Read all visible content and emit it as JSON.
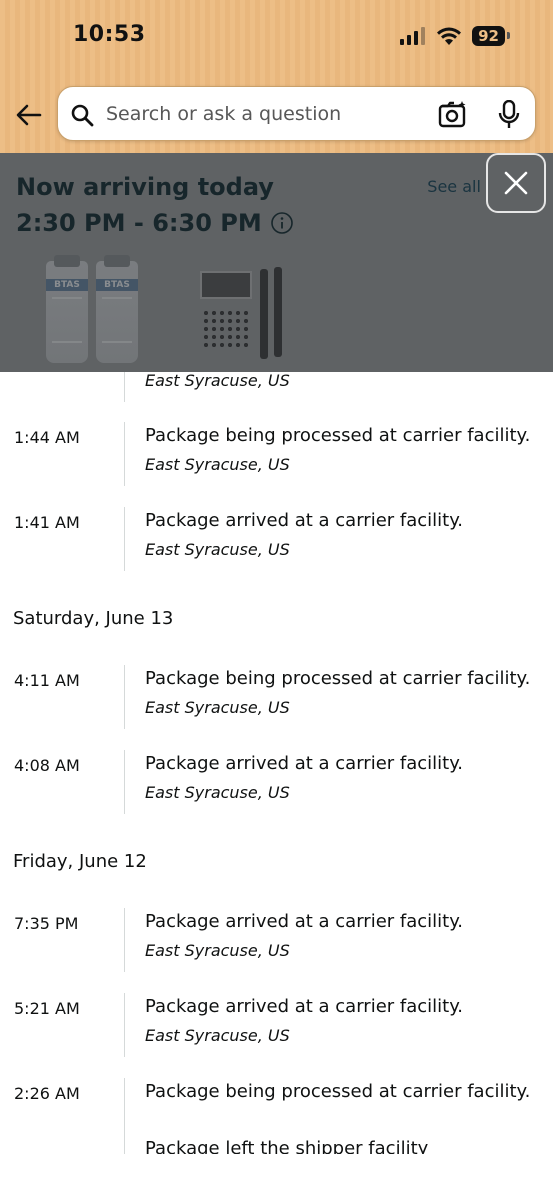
{
  "status_bar": {
    "time": "10:53",
    "battery": "92"
  },
  "search": {
    "placeholder": "Search or ask a question"
  },
  "arrival": {
    "title": "Now arriving today",
    "window": "2:30 PM - 6:30 PM",
    "see_all": "See all orders",
    "products": [
      "BTAS",
      "BTAS"
    ]
  },
  "timeline": {
    "partial_location": "East Syracuse, US",
    "groups": [
      {
        "date": "",
        "events": [
          {
            "time": "1:44 AM",
            "event": "Package being processed at carrier facility.",
            "location": "East Syracuse, US"
          },
          {
            "time": "1:41 AM",
            "event": "Package arrived at a carrier facility.",
            "location": "East Syracuse, US"
          }
        ]
      },
      {
        "date": "Saturday, June 13",
        "events": [
          {
            "time": "4:11 AM",
            "event": "Package being processed at carrier facility.",
            "location": "East Syracuse, US"
          },
          {
            "time": "4:08 AM",
            "event": "Package arrived at a carrier facility.",
            "location": "East Syracuse, US"
          }
        ]
      },
      {
        "date": "Friday, June 12",
        "events": [
          {
            "time": "7:35 PM",
            "event": "Package arrived at a carrier facility.",
            "location": "East Syracuse, US"
          },
          {
            "time": "5:21 AM",
            "event": "Package arrived at a carrier facility.",
            "location": "East Syracuse, US"
          },
          {
            "time": "2:26 AM",
            "event": "Package being processed at carrier facility.",
            "location": ""
          }
        ]
      }
    ],
    "cut_off_event": "Package left the shipper facility"
  },
  "colors": {
    "header_bg": "#edbe86",
    "overlay_bg": "#5f6264",
    "timeline_line": "#d5d9d9"
  }
}
